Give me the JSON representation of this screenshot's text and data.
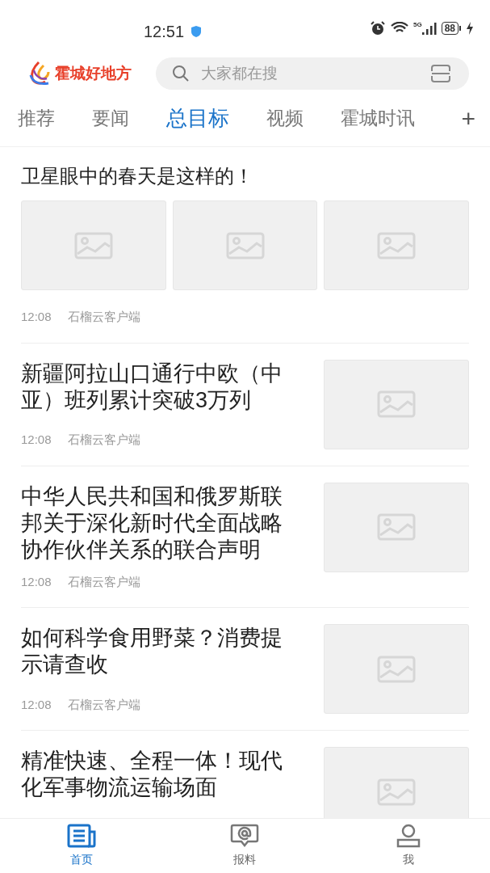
{
  "status_bar": {
    "time": "12:51",
    "network": "5G",
    "battery": "88"
  },
  "header": {
    "app_name": "霍城好地方",
    "search": {
      "placeholder": "大家都在搜"
    }
  },
  "tabs": [
    {
      "label": "推荐",
      "selected": false
    },
    {
      "label": "要闻",
      "selected": false
    },
    {
      "label": "总目标",
      "selected": true
    },
    {
      "label": "视频",
      "selected": false
    },
    {
      "label": "霍城时讯",
      "selected": false
    }
  ],
  "add_tab": "+",
  "articles": [
    {
      "kind": "gallery",
      "title": "卫星眼中的春天是这样的！",
      "time": "12:08",
      "source": "石榴云客户端"
    },
    {
      "kind": "thumb",
      "title": "新疆阿拉山口通行中欧（中亚）班列累计突破3万列",
      "time": "12:08",
      "source": "石榴云客户端"
    },
    {
      "kind": "thumb",
      "title": "中华人民共和国和俄罗斯联邦关于深化新时代全面战略协作伙伴关系的联合声明",
      "time": "12:08",
      "source": "石榴云客户端"
    },
    {
      "kind": "thumb",
      "title": "如何科学食用野菜？消费提示请查收",
      "time": "12:08",
      "source": "石榴云客户端"
    },
    {
      "kind": "thumb",
      "title": "精准快速、全程一体！现代化军事物流运输场面"
    }
  ],
  "bottom_nav": [
    {
      "label": "首页",
      "kind": "news",
      "selected": true
    },
    {
      "label": "报料",
      "kind": "report",
      "selected": false
    },
    {
      "label": "我",
      "kind": "user",
      "selected": false
    }
  ]
}
